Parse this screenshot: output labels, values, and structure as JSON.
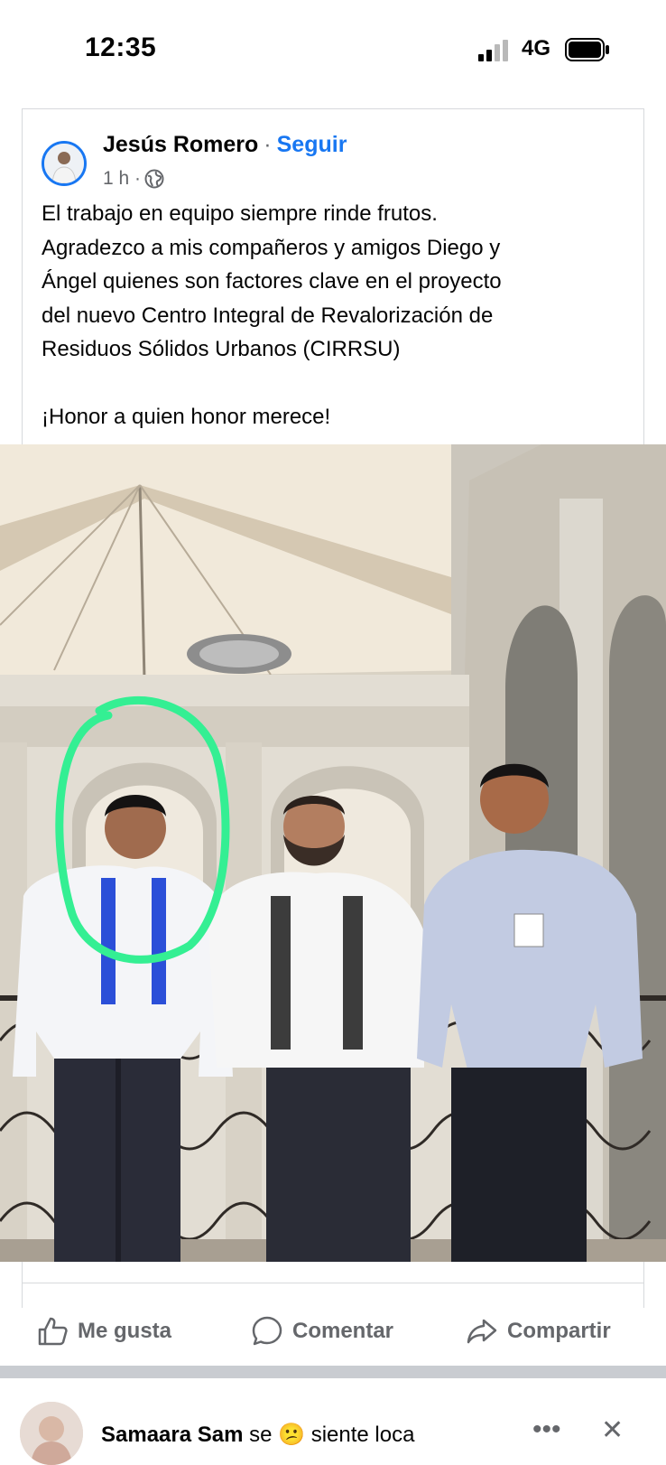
{
  "status_bar": {
    "time": "12:35",
    "network": "4G",
    "icons": [
      "signal-icon",
      "battery-icon"
    ]
  },
  "post": {
    "author": "Jesús Romero",
    "separator": "·",
    "follow_label": "Seguir",
    "time_ago": "1 h ·",
    "privacy_icon": "globe-icon",
    "text_lines": [
      "El trabajo en equipo siempre rinde frutos.",
      "Agradezco a mis compañeros y amigos Diego y",
      "Ángel quienes son factores clave en el proyecto",
      "del nuevo Centro Integral de Revalorización de",
      "Residuos Sólidos Urbanos (CIRRSU)"
    ],
    "closing_line": "¡Honor a quien honor merece!",
    "photo_icon": "group-photo-image",
    "actions": {
      "like": "Me gusta",
      "comment": "Comentar",
      "share": "Compartir"
    }
  },
  "next_post": {
    "author": "Samaara Sam",
    "text": "se 😕 siente loca"
  },
  "colors": {
    "brand": "#1877f2",
    "secondary_text": "#65676b",
    "highlight_circle": "#34ef93"
  }
}
